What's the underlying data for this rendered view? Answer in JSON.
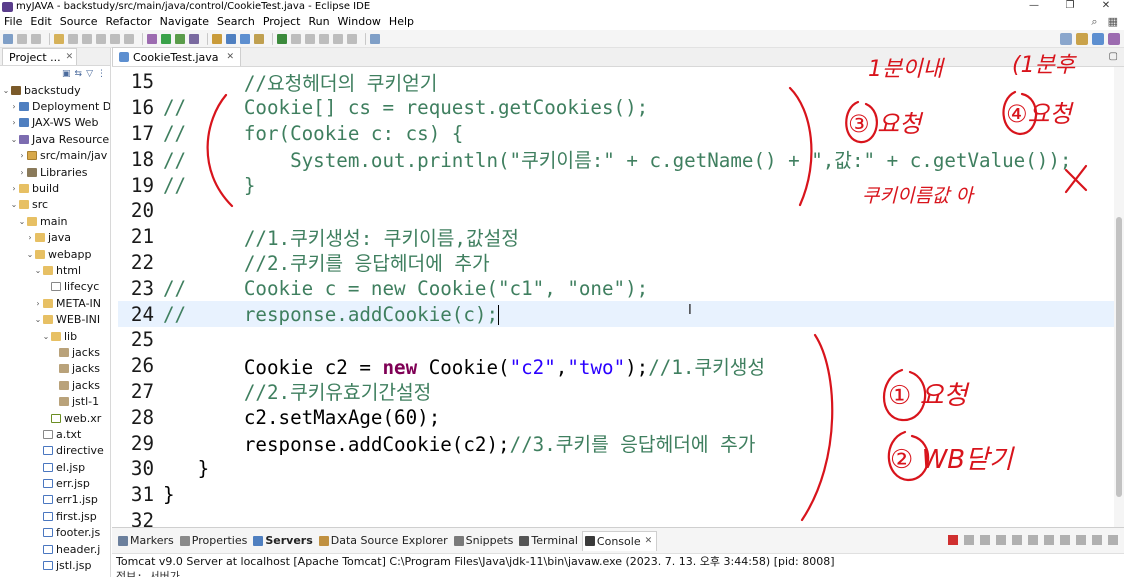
{
  "window": {
    "title": "myJAVA - backstudy/src/main/java/control/CookieTest.java - Eclipse IDE",
    "controls": [
      "—",
      "❐",
      "✕"
    ]
  },
  "menu": [
    "File",
    "Edit",
    "Source",
    "Refactor",
    "Navigate",
    "Search",
    "Project",
    "Run",
    "Window",
    "Help"
  ],
  "explorer": {
    "tab_label": "Project ...",
    "items": [
      {
        "label": "backstudy",
        "icon": "project-icon",
        "kind": "proj",
        "indent": 0,
        "twisty": "⌄"
      },
      {
        "label": "Deployment D",
        "icon": "deployment-icon",
        "kind": "srv",
        "indent": 1,
        "twisty": "›"
      },
      {
        "label": "JAX-WS Web",
        "icon": "webservice-icon",
        "kind": "srv",
        "indent": 1,
        "twisty": "›"
      },
      {
        "label": "Java Resource",
        "icon": "java-resources-icon",
        "kind": "javares",
        "indent": 1,
        "twisty": "⌄"
      },
      {
        "label": "src/main/jav",
        "icon": "source-folder-icon",
        "kind": "pkgfolder",
        "indent": 2,
        "twisty": "›"
      },
      {
        "label": "Libraries",
        "icon": "libraries-icon",
        "kind": "lib",
        "indent": 2,
        "twisty": "›"
      },
      {
        "label": "build",
        "icon": "folder-icon",
        "kind": "folder",
        "indent": 1,
        "twisty": "›"
      },
      {
        "label": "src",
        "icon": "folder-icon",
        "kind": "folder",
        "indent": 1,
        "twisty": "⌄"
      },
      {
        "label": "main",
        "icon": "folder-icon",
        "kind": "folder",
        "indent": 2,
        "twisty": "⌄"
      },
      {
        "label": "java",
        "icon": "folder-icon",
        "kind": "folder",
        "indent": 3,
        "twisty": "›"
      },
      {
        "label": "webapp",
        "icon": "folder-icon",
        "kind": "folder",
        "indent": 3,
        "twisty": "⌄"
      },
      {
        "label": "html",
        "icon": "folder-icon",
        "kind": "folder",
        "indent": 4,
        "twisty": "⌄"
      },
      {
        "label": "lifecyc",
        "icon": "file-icon",
        "kind": "file",
        "indent": 5,
        "twisty": ""
      },
      {
        "label": "META-IN",
        "icon": "folder-icon",
        "kind": "folder",
        "indent": 4,
        "twisty": "›"
      },
      {
        "label": "WEB-INI",
        "icon": "folder-icon",
        "kind": "folder",
        "indent": 4,
        "twisty": "⌄"
      },
      {
        "label": "lib",
        "icon": "folder-icon",
        "kind": "folder",
        "indent": 5,
        "twisty": "⌄"
      },
      {
        "label": "jacks",
        "icon": "jar-icon",
        "kind": "jar",
        "indent": 6,
        "twisty": ""
      },
      {
        "label": "jacks",
        "icon": "jar-icon",
        "kind": "jar",
        "indent": 6,
        "twisty": ""
      },
      {
        "label": "jacks",
        "icon": "jar-icon",
        "kind": "jar",
        "indent": 6,
        "twisty": ""
      },
      {
        "label": "jstl-1",
        "icon": "jar-icon",
        "kind": "jar",
        "indent": 6,
        "twisty": ""
      },
      {
        "label": "web.xr",
        "icon": "xml-file-icon",
        "kind": "xml",
        "indent": 5,
        "twisty": ""
      },
      {
        "label": "a.txt",
        "icon": "text-file-icon",
        "kind": "file",
        "indent": 4,
        "twisty": ""
      },
      {
        "label": "directive",
        "icon": "jsp-file-icon",
        "kind": "jsp",
        "indent": 4,
        "twisty": ""
      },
      {
        "label": "el.jsp",
        "icon": "jsp-file-icon",
        "kind": "jsp",
        "indent": 4,
        "twisty": ""
      },
      {
        "label": "err.jsp",
        "icon": "jsp-file-icon",
        "kind": "jsp",
        "indent": 4,
        "twisty": ""
      },
      {
        "label": "err1.jsp",
        "icon": "jsp-file-icon",
        "kind": "jsp",
        "indent": 4,
        "twisty": ""
      },
      {
        "label": "first.jsp",
        "icon": "jsp-file-icon",
        "kind": "jsp",
        "indent": 4,
        "twisty": ""
      },
      {
        "label": "footer.js",
        "icon": "jsp-file-icon",
        "kind": "jsp",
        "indent": 4,
        "twisty": ""
      },
      {
        "label": "header.j",
        "icon": "jsp-file-icon",
        "kind": "jsp",
        "indent": 4,
        "twisty": ""
      },
      {
        "label": "jstl.jsp",
        "icon": "jsp-file-icon",
        "kind": "jsp",
        "indent": 4,
        "twisty": ""
      }
    ]
  },
  "editor": {
    "tab_label": "CookieTest.java",
    "lines": [
      {
        "num": "15",
        "marker": false,
        "current": false,
        "tokens": [
          {
            "t": "       ",
            "c": "plain"
          },
          {
            "t": "//요청헤더의 쿠키얻기",
            "c": "cm"
          }
        ]
      },
      {
        "num": "16",
        "marker": false,
        "current": false,
        "tokens": [
          {
            "t": "//     Cookie[] cs = request.getCookies();",
            "c": "cm"
          }
        ]
      },
      {
        "num": "17",
        "marker": false,
        "current": false,
        "tokens": [
          {
            "t": "//     for(Cookie c: cs) {",
            "c": "cm"
          }
        ]
      },
      {
        "num": "18",
        "marker": false,
        "current": false,
        "tokens": [
          {
            "t": "//         System.out.println(\"쿠키이름:\" + c.getName() + \",값:\" + c.getValue());",
            "c": "cm"
          }
        ]
      },
      {
        "num": "19",
        "marker": false,
        "current": false,
        "tokens": [
          {
            "t": "//     }",
            "c": "cm"
          }
        ]
      },
      {
        "num": "20",
        "marker": false,
        "current": false,
        "tokens": []
      },
      {
        "num": "21",
        "marker": false,
        "current": false,
        "tokens": [
          {
            "t": "       ",
            "c": "plain"
          },
          {
            "t": "//1.쿠키생성: 쿠키이름,값설정",
            "c": "cm"
          }
        ]
      },
      {
        "num": "22",
        "marker": false,
        "current": false,
        "tokens": [
          {
            "t": "       ",
            "c": "plain"
          },
          {
            "t": "//2.쿠키를 응답헤더에 추가",
            "c": "cm"
          }
        ]
      },
      {
        "num": "23",
        "marker": false,
        "current": false,
        "tokens": [
          {
            "t": "//     Cookie c = new Cookie(\"c1\", \"one\");",
            "c": "cm"
          }
        ]
      },
      {
        "num": "24",
        "marker": false,
        "current": true,
        "tokens": [
          {
            "t": "//     response.addCookie(c);",
            "c": "cm"
          }
        ]
      },
      {
        "num": "25",
        "marker": false,
        "current": false,
        "tokens": []
      },
      {
        "num": "26",
        "marker": false,
        "current": false,
        "tokens": [
          {
            "t": "       Cookie ",
            "c": "plain"
          },
          {
            "t": "c2",
            "c": "plain"
          },
          {
            "t": " = ",
            "c": "plain"
          },
          {
            "t": "new",
            "c": "kw"
          },
          {
            "t": " Cookie(",
            "c": "plain"
          },
          {
            "t": "\"c2\"",
            "c": "str"
          },
          {
            "t": ",",
            "c": "plain"
          },
          {
            "t": "\"two\"",
            "c": "str"
          },
          {
            "t": ");",
            "c": "plain"
          },
          {
            "t": "//1.쿠키생성",
            "c": "cm"
          }
        ]
      },
      {
        "num": "27",
        "marker": false,
        "current": false,
        "tokens": [
          {
            "t": "       ",
            "c": "plain"
          },
          {
            "t": "//2.쿠키유효기간설정",
            "c": "cm"
          }
        ]
      },
      {
        "num": "28",
        "marker": false,
        "current": false,
        "tokens": [
          {
            "t": "       c2.setMaxAge(60);",
            "c": "plain"
          }
        ]
      },
      {
        "num": "29",
        "marker": false,
        "current": false,
        "tokens": [
          {
            "t": "       response.addCookie(c2);",
            "c": "plain"
          },
          {
            "t": "//3.쿠키를 응답헤더에 추가",
            "c": "cm"
          }
        ]
      },
      {
        "num": "30",
        "marker": false,
        "current": false,
        "tokens": [
          {
            "t": "   }",
            "c": "plain"
          }
        ]
      },
      {
        "num": "31",
        "marker": false,
        "current": false,
        "tokens": [
          {
            "t": "}",
            "c": "plain"
          }
        ]
      },
      {
        "num": "32",
        "marker": false,
        "current": false,
        "tokens": []
      }
    ]
  },
  "bottom": {
    "tabs": [
      {
        "label": "Markers",
        "icon": "markers-icon",
        "color": "#6b7f9c",
        "active": false,
        "bold": false
      },
      {
        "label": "Properties",
        "icon": "properties-icon",
        "color": "#8a8a8a",
        "active": false,
        "bold": false
      },
      {
        "label": "Servers",
        "icon": "servers-icon",
        "color": "#4f7fc0",
        "active": false,
        "bold": true
      },
      {
        "label": "Data Source Explorer",
        "icon": "data-source-icon",
        "color": "#c09040",
        "active": false,
        "bold": false
      },
      {
        "label": "Snippets",
        "icon": "snippets-icon",
        "color": "#7a7a7a",
        "active": false,
        "bold": false
      },
      {
        "label": "Terminal",
        "icon": "terminal-icon",
        "color": "#555555",
        "active": false,
        "bold": false
      },
      {
        "label": "Console",
        "icon": "console-icon",
        "color": "#3a3a3a",
        "active": true,
        "bold": false
      }
    ],
    "console_header": "Tomcat v9.0 Server at localhost [Apache Tomcat] C:\\Program Files\\Java\\jdk-11\\bin\\javaw.exe  (2023. 7. 13. 오후 3:44:58) [pid: 8008]",
    "console_output": "정보: 서버가 ..."
  },
  "annotations": {
    "top_note1": "1분이내",
    "top_note2": "(1분후",
    "step3": "③ 요청",
    "step4": "④요청",
    "cookie_note": "쿠키이름값 아",
    "x_mark": "X",
    "step1": "① 요청",
    "step2": "② WB닫기"
  },
  "colors": {
    "comment": "#3f7f5f",
    "keyword": "#7f0055",
    "string": "#2a00ff",
    "ink": "#d8141c",
    "current_line": "#e8f2fe"
  }
}
